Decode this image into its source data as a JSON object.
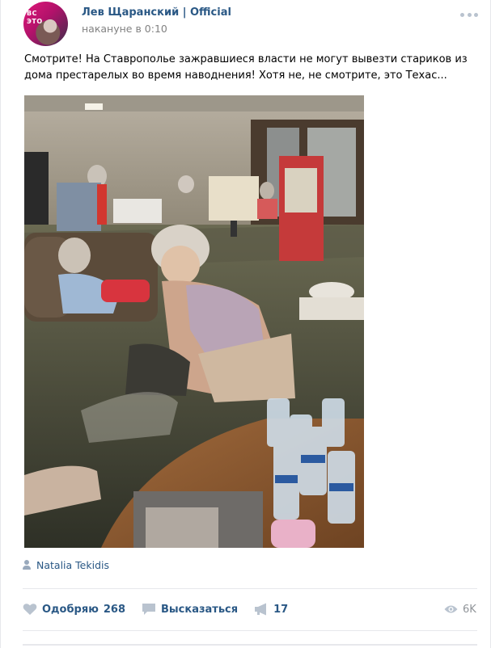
{
  "post": {
    "avatar_text": "ВС ЭТО",
    "author": "Лев Щаранский | Official",
    "time": "накануне в 0:10",
    "text": "Смотрите! На Ставрополье зажравшиеся власти не могут вывезти стариков из дома престарелых во время наводнения! Хотя не, не смотрите, это Техас...",
    "photo_credit": "Natalia Tekidis"
  },
  "actions": {
    "like_label": "Одобряю",
    "like_count": "268",
    "comment_label": "Высказаться",
    "share_count": "17",
    "views_count": "6K"
  },
  "colors": {
    "link": "#2a5885",
    "muted": "#828282",
    "icon": "#b9c3cf",
    "divider": "#e7e8ec"
  },
  "icons": [
    "more-icon",
    "person-icon",
    "heart-icon",
    "comment-icon",
    "megaphone-icon",
    "eye-icon"
  ]
}
